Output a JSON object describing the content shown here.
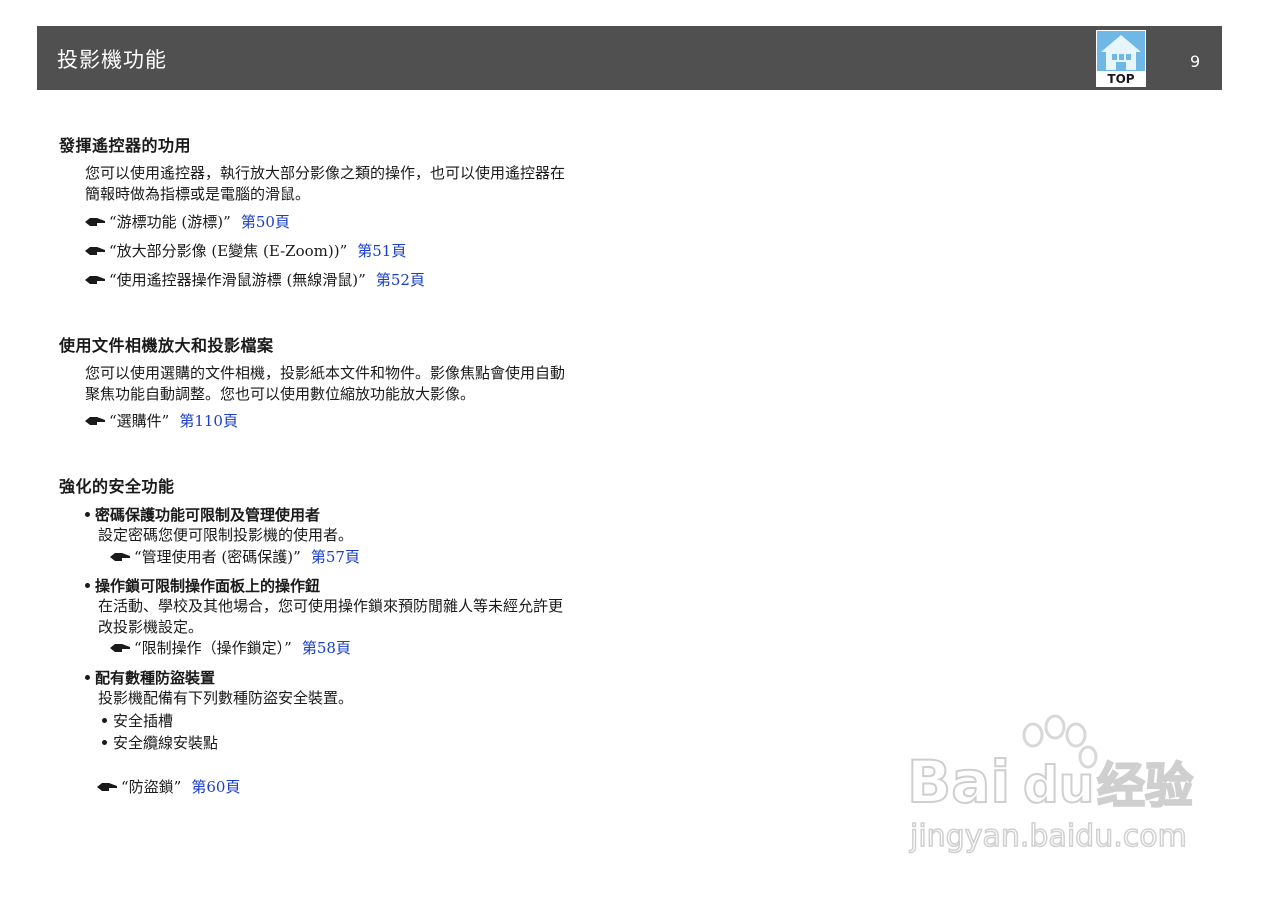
{
  "header": {
    "title": "投影機功能",
    "top_label": "TOP",
    "page_number": "9"
  },
  "sections": [
    {
      "heading": "發揮遙控器的功用",
      "paragraph_lines": [
        "您可以使用遙控器，執行放大部分影像之類的操作，也可以使用遙控器在",
        "簡報時做為指標或是電腦的滑鼠。"
      ],
      "refs": [
        {
          "text": "“游標功能 (游標)”",
          "page": "第50頁"
        },
        {
          "text": "“放大部分影像 (E變焦 (E-Zoom))”",
          "page": "第51頁"
        },
        {
          "text": "“使用遙控器操作滑鼠游標 (無線滑鼠)”",
          "page": "第52頁"
        }
      ]
    },
    {
      "heading": "使用文件相機放大和投影檔案",
      "paragraph_lines": [
        "您可以使用選購的文件相機，投影紙本文件和物件。影像焦點會使用自動",
        "聚焦功能自動調整。您也可以使用數位縮放功能放大影像。"
      ],
      "refs": [
        {
          "text": "“選購件”",
          "page": "第110頁"
        }
      ]
    },
    {
      "heading": "強化的安全功能",
      "bullets": [
        {
          "title": "密碼保護功能可限制及管理使用者",
          "body_lines": [
            "設定密碼您便可限制投影機的使用者。"
          ],
          "ref": {
            "text": "“管理使用者 (密碼保護)”",
            "page": "第57頁"
          }
        },
        {
          "title": "操作鎖可限制操作面板上的操作鈕",
          "body_lines": [
            "在活動、學校及其他場合，您可使用操作鎖來預防閒雜人等未經允許更",
            "改投影機設定。"
          ],
          "ref": {
            "text": "“限制操作（操作鎖定）”",
            "page": "第58頁"
          }
        },
        {
          "title": "配有數種防盜裝置",
          "body_lines": [
            "投影機配備有下列數種防盜安全裝置。"
          ],
          "sub_items": [
            "安全插槽",
            "安全纜線安裝點"
          ],
          "ref": {
            "text": "“防盜鎖”",
            "page": "第60頁"
          }
        }
      ]
    }
  ],
  "watermark": {
    "brand": "Bai",
    "brand2": "du",
    "brand_cn": "经验",
    "url": "jingyan.baidu.com"
  },
  "colors": {
    "header_bg": "#505050",
    "link": "#1a3fc6",
    "top_icon": "#5aaee0"
  }
}
